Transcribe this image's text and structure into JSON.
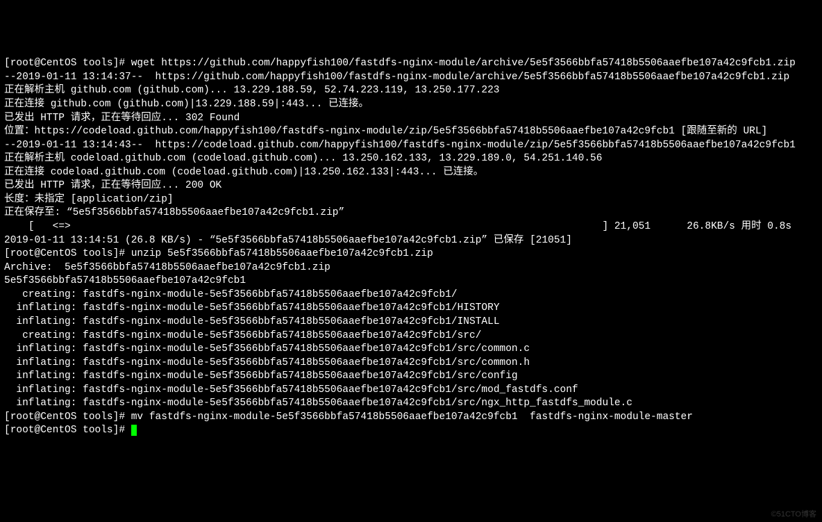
{
  "lines": [
    "[root@CentOS tools]# wget https://github.com/happyfish100/fastdfs-nginx-module/archive/5e5f3566bbfa57418b5506aaefbe107a42c9fcb1.zip",
    "--2019-01-11 13:14:37--  https://github.com/happyfish100/fastdfs-nginx-module/archive/5e5f3566bbfa57418b5506aaefbe107a42c9fcb1.zip",
    "正在解析主机 github.com (github.com)... 13.229.188.59, 52.74.223.119, 13.250.177.223",
    "正在连接 github.com (github.com)|13.229.188.59|:443... 已连接。",
    "已发出 HTTP 请求，正在等待回应... 302 Found",
    "位置：https://codeload.github.com/happyfish100/fastdfs-nginx-module/zip/5e5f3566bbfa57418b5506aaefbe107a42c9fcb1 [跟随至新的 URL]",
    "--2019-01-11 13:14:43--  https://codeload.github.com/happyfish100/fastdfs-nginx-module/zip/5e5f3566bbfa57418b5506aaefbe107a42c9fcb1",
    "正在解析主机 codeload.github.com (codeload.github.com)... 13.250.162.133, 13.229.189.0, 54.251.140.56",
    "正在连接 codeload.github.com (codeload.github.com)|13.250.162.133|:443... 已连接。",
    "已发出 HTTP 请求，正在等待回应... 200 OK",
    "长度：未指定 [application/zip]",
    "正在保存至: “5e5f3566bbfa57418b5506aaefbe107a42c9fcb1.zip”",
    "",
    "    [   <=>                                                                                        ] 21,051      26.8KB/s 用时 0.8s   ",
    "",
    "2019-01-11 13:14:51 (26.8 KB/s) - “5e5f3566bbfa57418b5506aaefbe107a42c9fcb1.zip” 已保存 [21051]",
    "",
    "[root@CentOS tools]# unzip 5e5f3566bbfa57418b5506aaefbe107a42c9fcb1.zip",
    "Archive:  5e5f3566bbfa57418b5506aaefbe107a42c9fcb1.zip",
    "5e5f3566bbfa57418b5506aaefbe107a42c9fcb1",
    "   creating: fastdfs-nginx-module-5e5f3566bbfa57418b5506aaefbe107a42c9fcb1/",
    "  inflating: fastdfs-nginx-module-5e5f3566bbfa57418b5506aaefbe107a42c9fcb1/HISTORY  ",
    "  inflating: fastdfs-nginx-module-5e5f3566bbfa57418b5506aaefbe107a42c9fcb1/INSTALL  ",
    "   creating: fastdfs-nginx-module-5e5f3566bbfa57418b5506aaefbe107a42c9fcb1/src/",
    "  inflating: fastdfs-nginx-module-5e5f3566bbfa57418b5506aaefbe107a42c9fcb1/src/common.c  ",
    "  inflating: fastdfs-nginx-module-5e5f3566bbfa57418b5506aaefbe107a42c9fcb1/src/common.h  ",
    "  inflating: fastdfs-nginx-module-5e5f3566bbfa57418b5506aaefbe107a42c9fcb1/src/config  ",
    "  inflating: fastdfs-nginx-module-5e5f3566bbfa57418b5506aaefbe107a42c9fcb1/src/mod_fastdfs.conf  ",
    "  inflating: fastdfs-nginx-module-5e5f3566bbfa57418b5506aaefbe107a42c9fcb1/src/ngx_http_fastdfs_module.c  ",
    "[root@CentOS tools]# mv fastdfs-nginx-module-5e5f3566bbfa57418b5506aaefbe107a42c9fcb1  fastdfs-nginx-module-master",
    "[root@CentOS tools]# "
  ],
  "watermark": "©51CTO博客"
}
